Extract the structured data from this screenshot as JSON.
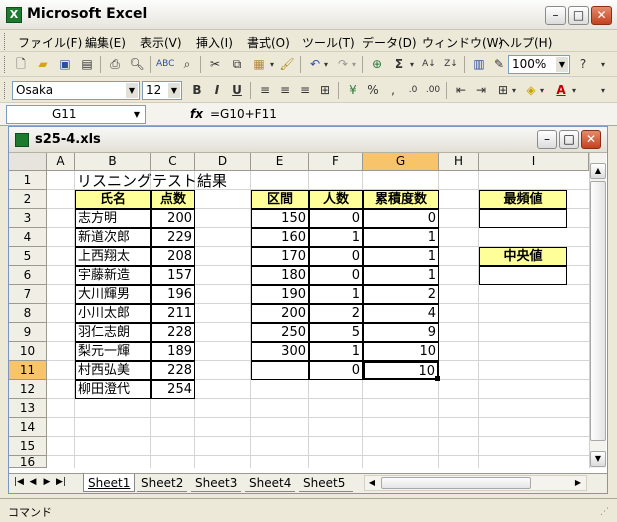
{
  "app": {
    "title": "Microsoft Excel"
  },
  "menu": [
    "ファイル(F)",
    "編集(E)",
    "表示(V)",
    "挿入(I)",
    "書式(O)",
    "ツール(T)",
    "データ(D)",
    "ウィンドウ(W)",
    "ヘルプ(H)"
  ],
  "toolbar": {
    "zoom": "100%",
    "font_name": "Osaka",
    "font_size": "12",
    "bold": "B",
    "italic": "I",
    "underline": "U",
    "sigma": "Σ"
  },
  "formula_bar": {
    "name_box": "G11",
    "fx_label": "fx",
    "formula": "=G10+F11"
  },
  "workbook": {
    "filename": "s25-4.xls"
  },
  "sheet": {
    "columns": [
      "A",
      "B",
      "C",
      "D",
      "E",
      "F",
      "G",
      "H",
      "I"
    ],
    "rows": [
      "1",
      "2",
      "3",
      "4",
      "5",
      "6",
      "7",
      "8",
      "9",
      "10",
      "11",
      "12",
      "13",
      "14",
      "15",
      "16"
    ],
    "selected_col": "G",
    "selected_row": "11",
    "title": "リスニングテスト結果",
    "left_table": {
      "headers": [
        "氏名",
        "点数"
      ],
      "rows": [
        [
          "志方明",
          "200"
        ],
        [
          "新道次郎",
          "229"
        ],
        [
          "上西翔太",
          "208"
        ],
        [
          "宇藤新造",
          "157"
        ],
        [
          "大川輝男",
          "196"
        ],
        [
          "小川太郎",
          "211"
        ],
        [
          "羽仁志朗",
          "228"
        ],
        [
          "梨元一輝",
          "189"
        ],
        [
          "村西弘美",
          "228"
        ],
        [
          "柳田澄代",
          "254"
        ]
      ]
    },
    "freq_table": {
      "headers": [
        "区間",
        "人数",
        "累積度数"
      ],
      "rows": [
        [
          "150",
          "0",
          "0"
        ],
        [
          "160",
          "1",
          "1"
        ],
        [
          "170",
          "0",
          "1"
        ],
        [
          "180",
          "0",
          "1"
        ],
        [
          "190",
          "1",
          "2"
        ],
        [
          "200",
          "2",
          "4"
        ],
        [
          "250",
          "5",
          "9"
        ],
        [
          "300",
          "1",
          "10"
        ],
        [
          "",
          "0",
          "10"
        ]
      ]
    },
    "stat_labels": {
      "mode": "最頻値",
      "median": "中央値"
    }
  },
  "tabs": [
    "Sheet1",
    "Sheet2",
    "Sheet3",
    "Sheet4",
    "Sheet5"
  ],
  "status": "コマンド"
}
